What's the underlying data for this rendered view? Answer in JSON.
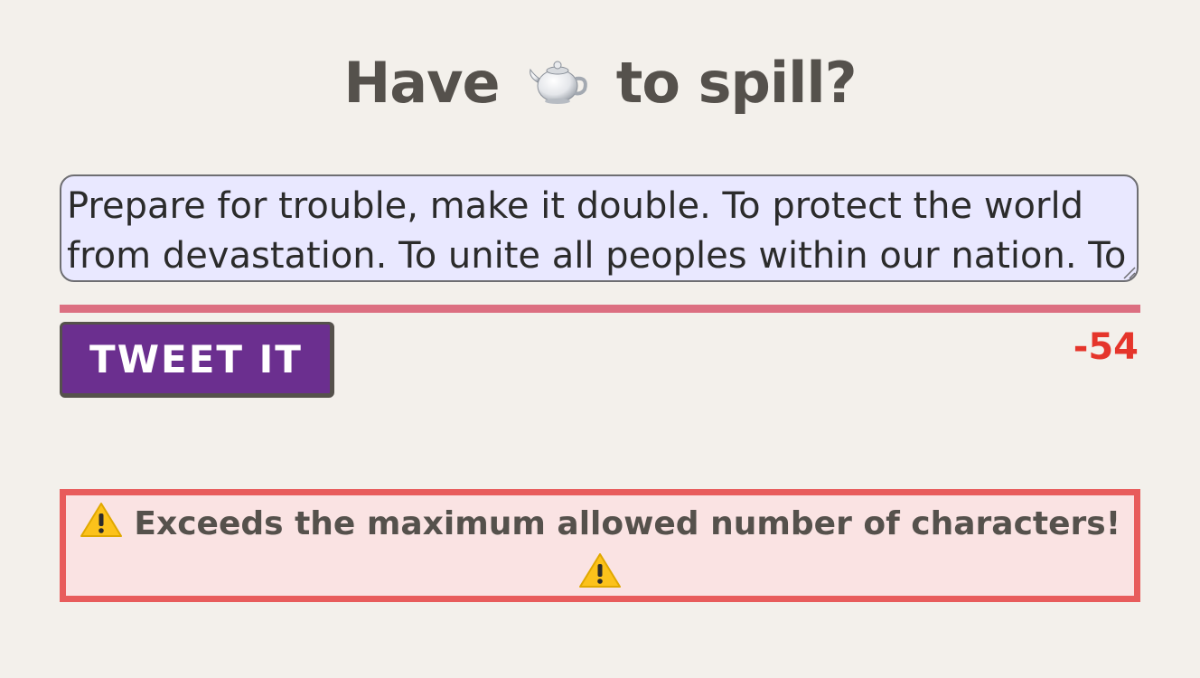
{
  "header": {
    "title_before": "Have",
    "title_after": "to spill?",
    "icon": "teapot-icon"
  },
  "compose": {
    "text": "Prepare for trouble, make it double. To protect the world from devastation. To unite all peoples within our nation. To"
  },
  "progress": {
    "fraction": 1.0,
    "color": "#dc6f81"
  },
  "actions": {
    "tweet_label": "TWEET IT",
    "tweet_color": "#6b2f8f"
  },
  "counter": {
    "value": "-54",
    "color": "#e5352b"
  },
  "warning": {
    "message": "Exceeds the maximum allowed number of characters!",
    "icon": "warning-icon",
    "border_color": "#e85c5c",
    "background": "#fae3e3"
  }
}
